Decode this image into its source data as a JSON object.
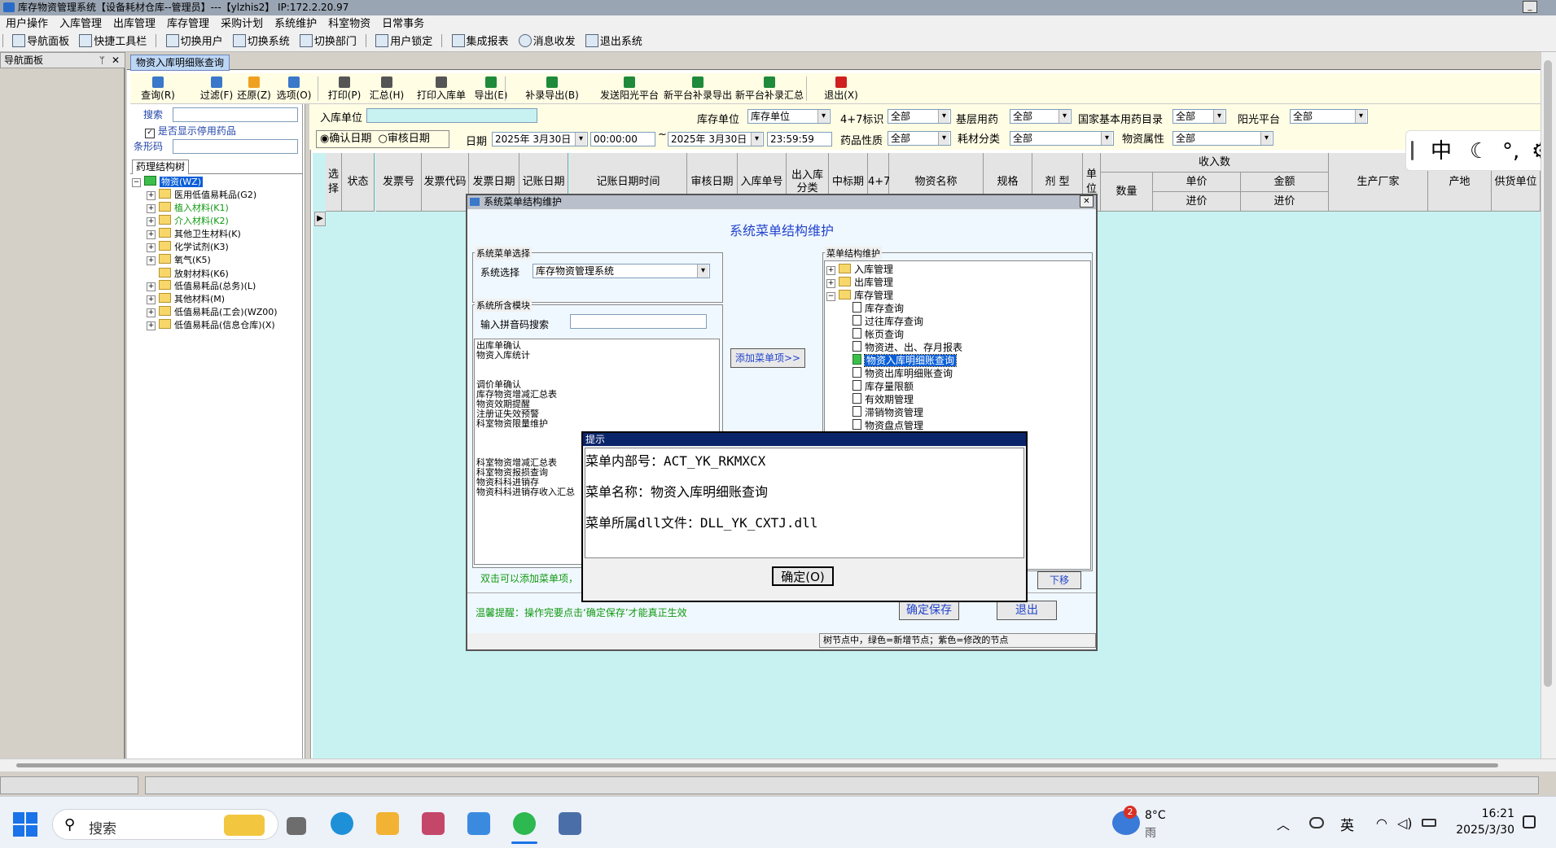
{
  "window": {
    "title": "库存物资管理系统【设备耗材仓库--管理员】---【ylzhis2】 IP:172.2.20.97"
  },
  "menu": [
    "用户操作",
    "入库管理",
    "出库管理",
    "库存管理",
    "采购计划",
    "系统维护",
    "科室物资",
    "日常事务"
  ],
  "quick_toolbar": [
    "导航面板",
    "快捷工具栏",
    "切换用户",
    "切换系统",
    "切换部门",
    "用户锁定",
    "集成报表",
    "消息收发",
    "退出系统"
  ],
  "nav_panel": {
    "title": "导航面板",
    "pin": "ᛘ",
    "close": "✕"
  },
  "tab": {
    "label": "物资入库明细账查询"
  },
  "func_toolbar": [
    {
      "label": "查询(R)",
      "color": "#3a78c9"
    },
    {
      "label": "过滤(F)",
      "color": "#3a78c9"
    },
    {
      "label": "还原(Z)",
      "color": "#f0a020"
    },
    {
      "label": "选项(O)",
      "color": "#3a78c9"
    },
    {
      "label": "打印(P)",
      "color": "#555555"
    },
    {
      "label": "汇总(H)",
      "color": "#555555"
    },
    {
      "label": "打印入库单",
      "color": "#555555"
    },
    {
      "label": "导出(E)",
      "color": "#1f8a3a"
    },
    {
      "label": "补录导出(B)",
      "color": "#1f8a3a"
    },
    {
      "label": "发送阳光平台",
      "color": "#1f8a3a"
    },
    {
      "label": "新平台补录导出",
      "color": "#1f8a3a"
    },
    {
      "label": "新平台补录汇总",
      "color": "#1f8a3a"
    },
    {
      "label": "退出(X)",
      "color": "#d02020"
    }
  ],
  "left": {
    "search_label": "搜索",
    "show_disabled": "是否显示停用药品",
    "barcode_label": "条形码",
    "tree_tab": "药理结构树",
    "tree": [
      {
        "label": "物资(WZ)",
        "selected": true,
        "green": false,
        "indent": 0,
        "expand": "−"
      },
      {
        "label": "医用低值易耗品(G2)",
        "green": false,
        "indent": 1,
        "expand": "+"
      },
      {
        "label": "植入材料(K1)",
        "green": true,
        "indent": 1,
        "expand": "+"
      },
      {
        "label": "介入材料(K2)",
        "green": true,
        "indent": 1,
        "expand": "+"
      },
      {
        "label": "其他卫生材料(K)",
        "green": false,
        "indent": 1,
        "expand": "+"
      },
      {
        "label": "化学试剂(K3)",
        "green": false,
        "indent": 1,
        "expand": "+"
      },
      {
        "label": "氧气(K5)",
        "green": false,
        "indent": 1,
        "expand": "+"
      },
      {
        "label": "放射材料(K6)",
        "green": false,
        "indent": 1,
        "expand": ""
      },
      {
        "label": "低值易耗品(总务)(L)",
        "green": false,
        "indent": 1,
        "expand": "+"
      },
      {
        "label": "其他材料(M)",
        "green": false,
        "indent": 1,
        "expand": "+"
      },
      {
        "label": "低值易耗品(工会)(WZ00)",
        "green": false,
        "indent": 1,
        "expand": "+"
      },
      {
        "label": "低值易耗品(信息仓库)(X)",
        "green": false,
        "indent": 1,
        "expand": "+"
      }
    ]
  },
  "filters": {
    "in_unit_label": "入库单位",
    "confirm_date": "确认日期",
    "audit_date": "审核日期",
    "date_label": "日期",
    "date_from": "2025年 3月30日",
    "time_from": "00:00:00",
    "tilde": "~",
    "date_to": "2025年 3月30日",
    "time_to": "23:59:59",
    "stock_unit_label": "库存单位",
    "stock_unit_value": "库存单位",
    "four_seven_label": "4+7标识",
    "four_seven_value": "全部",
    "basic_drug_label": "基层用药",
    "basic_drug_value": "全部",
    "national_label": "国家基本用药目录",
    "national_value": "全部",
    "sun_label": "阳光平台",
    "sun_value": "全部",
    "drug_prop_label": "药品性质",
    "drug_prop_value": "全部",
    "material_cat_label": "耗材分类",
    "material_cat_value": "全部",
    "material_attr_label": "物资属性",
    "material_attr_value": "全部"
  },
  "grid": {
    "columns": [
      "选择",
      "状态",
      "发票号",
      "发票代码",
      "发票日期",
      "记账日期",
      "记账日期时间",
      "审核日期",
      "入库单号",
      "出入库分类",
      "中标期",
      "4+7",
      "物资名称",
      "规格",
      "剂 型",
      "单位",
      "收入数",
      "生产厂家",
      "产地",
      "供货单位"
    ],
    "income_sub": [
      "数量",
      "单价",
      "金额",
      "进价",
      "进价"
    ]
  },
  "dialog": {
    "title": "系统菜单结构维护",
    "heading": "系统菜单结构维护",
    "select_group": "系统菜单选择",
    "system_label": "系统选择",
    "system_value": "库存物资管理系统",
    "modules_group": "系统所含模块",
    "pinyin_label": "输入拼音码搜索",
    "modules": [
      "出库单确认",
      "物资入库统计",
      "",
      "",
      "调价单确认",
      "库存物资增减汇总表",
      "物资效期提醒",
      "注册证失效预警",
      "科室物资限量维护",
      "",
      "",
      "",
      "科室物资增减汇总表",
      "科室物资报损查询",
      "物资科科进销存",
      "物资科科进销存收入汇总"
    ],
    "add_button": "添加菜单项>>",
    "tree_group": "菜单结构维护",
    "menu_tree": [
      {
        "label": "入库管理",
        "indent": 0,
        "expand": "+",
        "folder": true
      },
      {
        "label": "出库管理",
        "indent": 0,
        "expand": "+",
        "folder": true
      },
      {
        "label": "库存管理",
        "indent": 0,
        "expand": "−",
        "folder": true
      },
      {
        "label": "库存查询",
        "indent": 1,
        "expand": "",
        "folder": false
      },
      {
        "label": "过往库存查询",
        "indent": 1,
        "expand": "",
        "folder": false
      },
      {
        "label": "帐页查询",
        "indent": 1,
        "expand": "",
        "folder": false
      },
      {
        "label": "物资进、出、存月报表",
        "indent": 1,
        "expand": "",
        "folder": false
      },
      {
        "label": "物资入库明细账查询",
        "indent": 1,
        "expand": "",
        "folder": false,
        "selected": true
      },
      {
        "label": "物资出库明细账查询",
        "indent": 1,
        "expand": "",
        "folder": false
      },
      {
        "label": "库存量限额",
        "indent": 1,
        "expand": "",
        "folder": false
      },
      {
        "label": "有效期管理",
        "indent": 1,
        "expand": "",
        "folder": false
      },
      {
        "label": "滞销物资管理",
        "indent": 1,
        "expand": "",
        "folder": false
      },
      {
        "label": "物资盘点管理",
        "indent": 1,
        "expand": "",
        "folder": false
      }
    ],
    "dbl_hint": "双击可以添加菜单项，",
    "move_down": "下移",
    "reminder": "温馨提醒：操作完要点击‘确定保存’才能真正生效",
    "save_button": "确定保存",
    "exit_button": "退出",
    "status": "树节点中，绿色=新增节点；紫色=修改的节点",
    "close": "✕"
  },
  "alert": {
    "title": "提示",
    "line1": "菜单内部号：ACT_YK_RKMXCX",
    "line2": "菜单名称：物资入库明细账查询",
    "line3": "菜单所属dll文件：DLL_YK_CXTJ.dll",
    "ok": "确定(O)"
  },
  "ime": {
    "items": [
      "中",
      "☾",
      "°,",
      "⚙"
    ]
  },
  "taskbar": {
    "search_placeholder": "搜索",
    "weather_temp": "8°C",
    "weather_desc": "雨",
    "weather_badge": "2",
    "lang": "英",
    "time": "16:21",
    "date": "2025/3/30"
  },
  "colors": {
    "accent": "#0a246a",
    "grid_bg": "#c8f2f2",
    "toolbar_bg": "#fffde4"
  }
}
